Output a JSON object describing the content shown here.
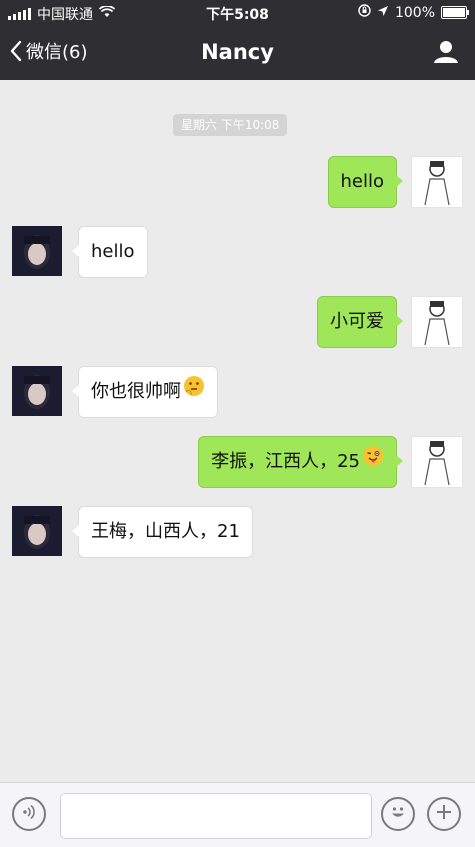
{
  "status_bar": {
    "carrier": "中国联通",
    "time": "下午5:08",
    "battery": "100%",
    "icons": [
      "signal-icon",
      "wifi-icon",
      "orientation-lock-icon",
      "location-icon",
      "battery-icon"
    ]
  },
  "nav": {
    "back_label": "微信(6)",
    "title": "Nancy",
    "icons": [
      "back-chevron-icon",
      "profile-icon"
    ]
  },
  "chat": {
    "timestamp": "星期六 下午10:08",
    "messages": [
      {
        "side": "right",
        "text": "hello"
      },
      {
        "side": "left",
        "text": "hello"
      },
      {
        "side": "right",
        "text": "小可爱"
      },
      {
        "side": "left",
        "text": "你也很帅啊",
        "emoji": "thinking-face-emoji"
      },
      {
        "side": "right",
        "text": "李振，江西人，25",
        "emoji": "winking-tongue-emoji"
      },
      {
        "side": "left",
        "text": "王梅，山西人，21"
      }
    ]
  },
  "input_bar": {
    "placeholder": "",
    "icons": [
      "voice-icon",
      "emoji-face-icon",
      "plus-icon"
    ]
  },
  "colors": {
    "header_bg": "#2f2f33",
    "chat_bg": "#ebebeb",
    "sent_bubble": "#9fe658",
    "received_bubble": "#ffffff"
  }
}
